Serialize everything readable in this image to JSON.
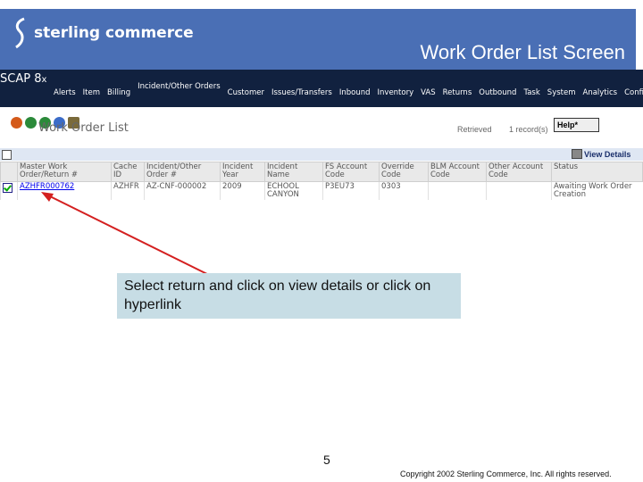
{
  "slide": {
    "title": "Work Order List Screen",
    "page_number": "5",
    "copyright": "Copyright 2002 Sterling Commerce, Inc. All rights reserved.",
    "callout_text": "Select return and click on view details or click on hyperlink"
  },
  "brand": {
    "logo_text": "sterling commerce",
    "banner_color": "#4a6fb5"
  },
  "app": {
    "name": "SCAP 8",
    "name_suffix": "x",
    "menu": [
      "Alerts",
      "Item",
      "Billing",
      "Incident/Other Orders",
      "Customer",
      "Issues/Transfers",
      "Inbound",
      "Inventory",
      "VAS",
      "Returns",
      "Outbound",
      "Task",
      "System",
      "Analytics",
      "Config"
    ]
  },
  "toolbar": {
    "screen_title": "Work Order List",
    "retrieved_label": "Retrieved",
    "records_label": "1 record(s)",
    "help_label": "Help*",
    "view_details_label": "View Details"
  },
  "grid": {
    "columns": [
      "Master Work Order/Return #",
      "Cache ID",
      "Incident/Other Order #",
      "Incident Year",
      "Incident Name",
      "FS Account Code",
      "Override Code",
      "BLM Account Code",
      "Other Account Code",
      "Status"
    ],
    "rows": [
      {
        "order": "AZHFR000762",
        "cache_id": "AZHFR",
        "incident_order": "AZ-CNF-000002",
        "year": "2009",
        "name": "ECHOOL CANYON",
        "fs_code": "P3EU73",
        "override": "0303",
        "blm_code": "",
        "other_code": "",
        "status": "Awaiting Work Order Creation"
      }
    ]
  }
}
